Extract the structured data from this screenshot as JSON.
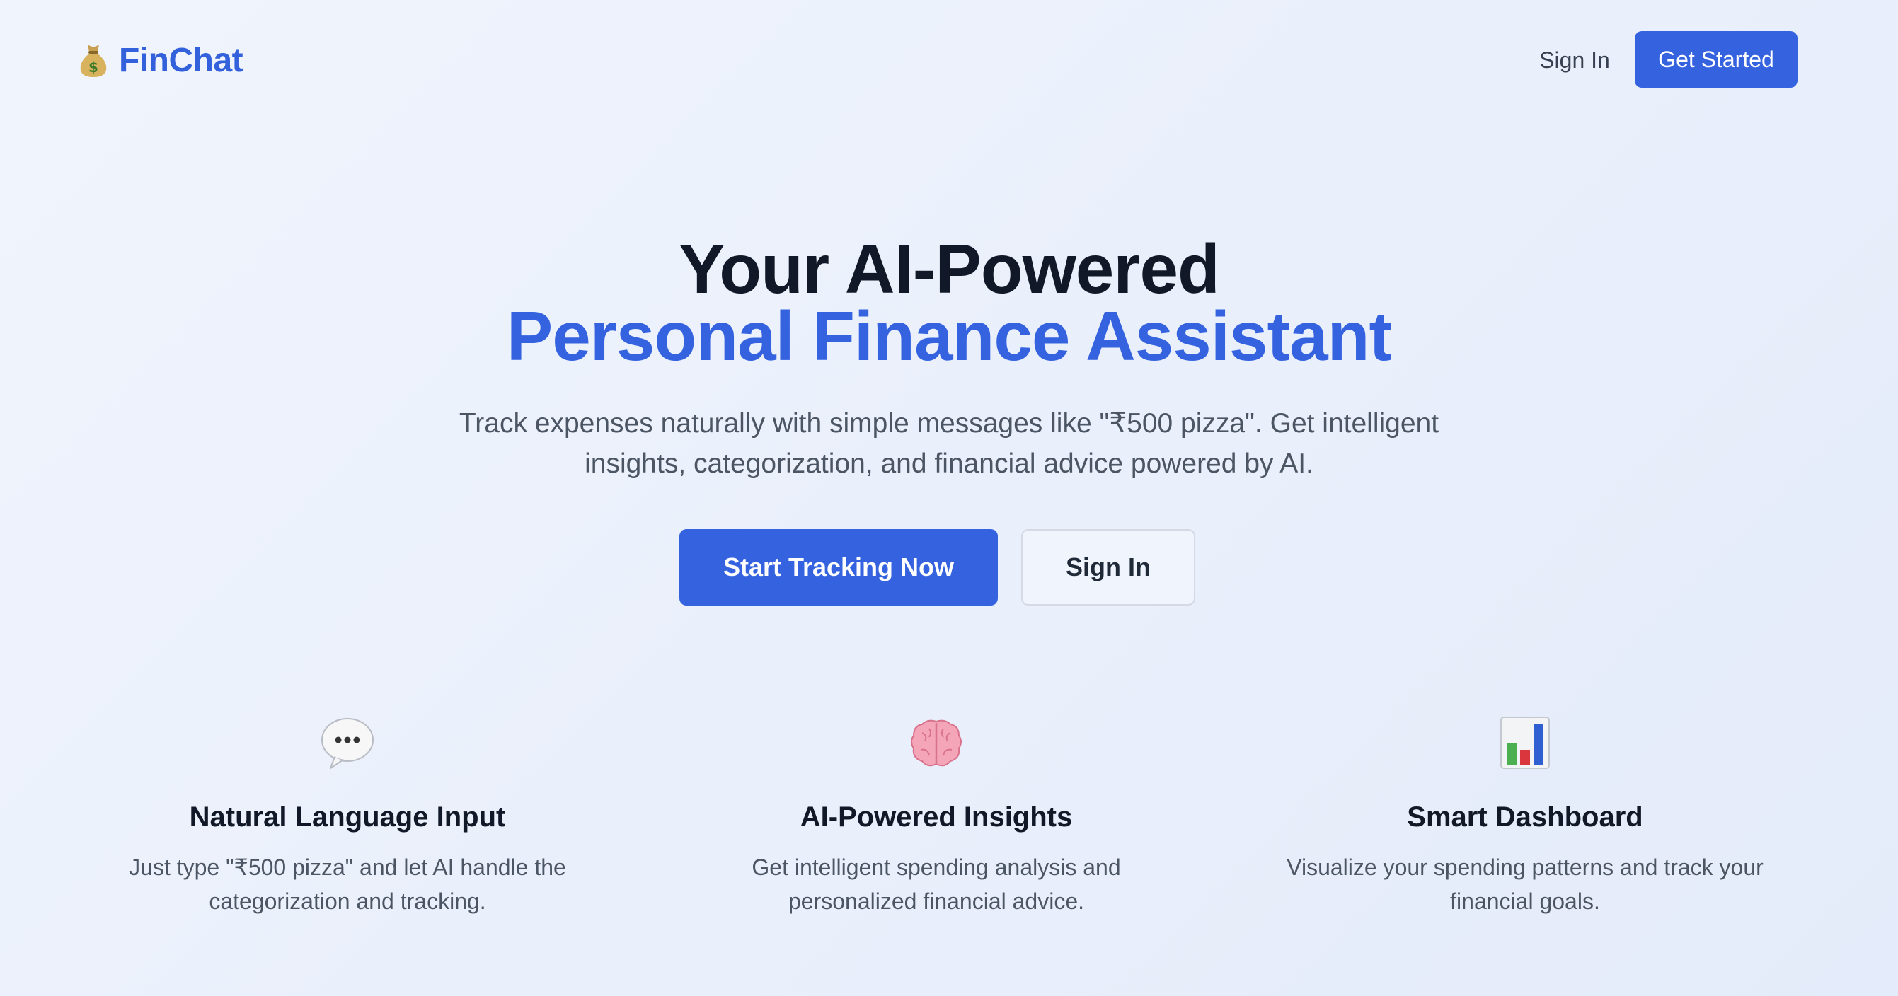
{
  "header": {
    "logo_icon": "money-bag-icon",
    "brand": "FinChat",
    "nav_signin": "Sign In",
    "nav_get_started": "Get Started"
  },
  "hero": {
    "title_line1": "Your AI-Powered",
    "title_line2": "Personal Finance Assistant",
    "subtitle": "Track expenses naturally with simple messages like \"₹500 pizza\". Get intelligent insights, categorization, and financial advice powered by AI.",
    "primary_cta": "Start Tracking Now",
    "secondary_cta": "Sign In"
  },
  "features": [
    {
      "icon": "speech-bubble-icon",
      "title": "Natural Language Input",
      "description": "Just type \"₹500 pizza\" and let AI handle the categorization and tracking."
    },
    {
      "icon": "brain-icon",
      "title": "AI-Powered Insights",
      "description": "Get intelligent spending analysis and personalized financial advice."
    },
    {
      "icon": "bar-chart-icon",
      "title": "Smart Dashboard",
      "description": "Visualize your spending patterns and track your financial goals."
    }
  ],
  "colors": {
    "accent": "#3563e0",
    "heading": "#111827",
    "body_text": "#4b5563",
    "background": "#eaf0fb"
  }
}
